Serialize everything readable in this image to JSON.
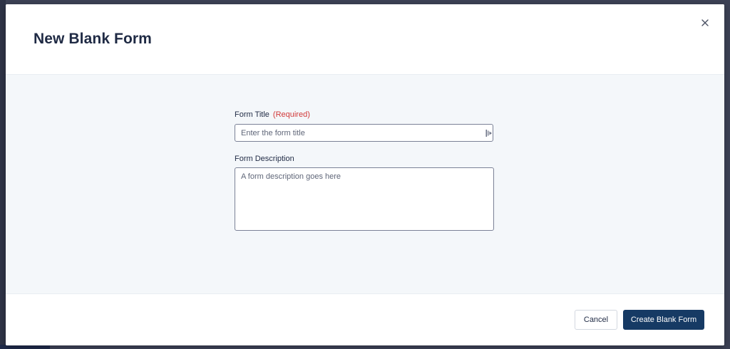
{
  "modal": {
    "title": "New Blank Form",
    "close_icon": "close-icon"
  },
  "form": {
    "title_field": {
      "label": "Form Title",
      "required_text": "(Required)",
      "placeholder": "Enter the form title",
      "value": "",
      "extension_icon": "password-manager-icon"
    },
    "description_field": {
      "label": "Form Description",
      "placeholder": "A form description goes here",
      "value": ""
    }
  },
  "footer": {
    "cancel_label": "Cancel",
    "create_label": "Create Blank Form"
  },
  "colors": {
    "primary": "#163a64",
    "required": "#d13838",
    "title_text": "#1f2a44",
    "body_bg": "#f4f7fa"
  }
}
